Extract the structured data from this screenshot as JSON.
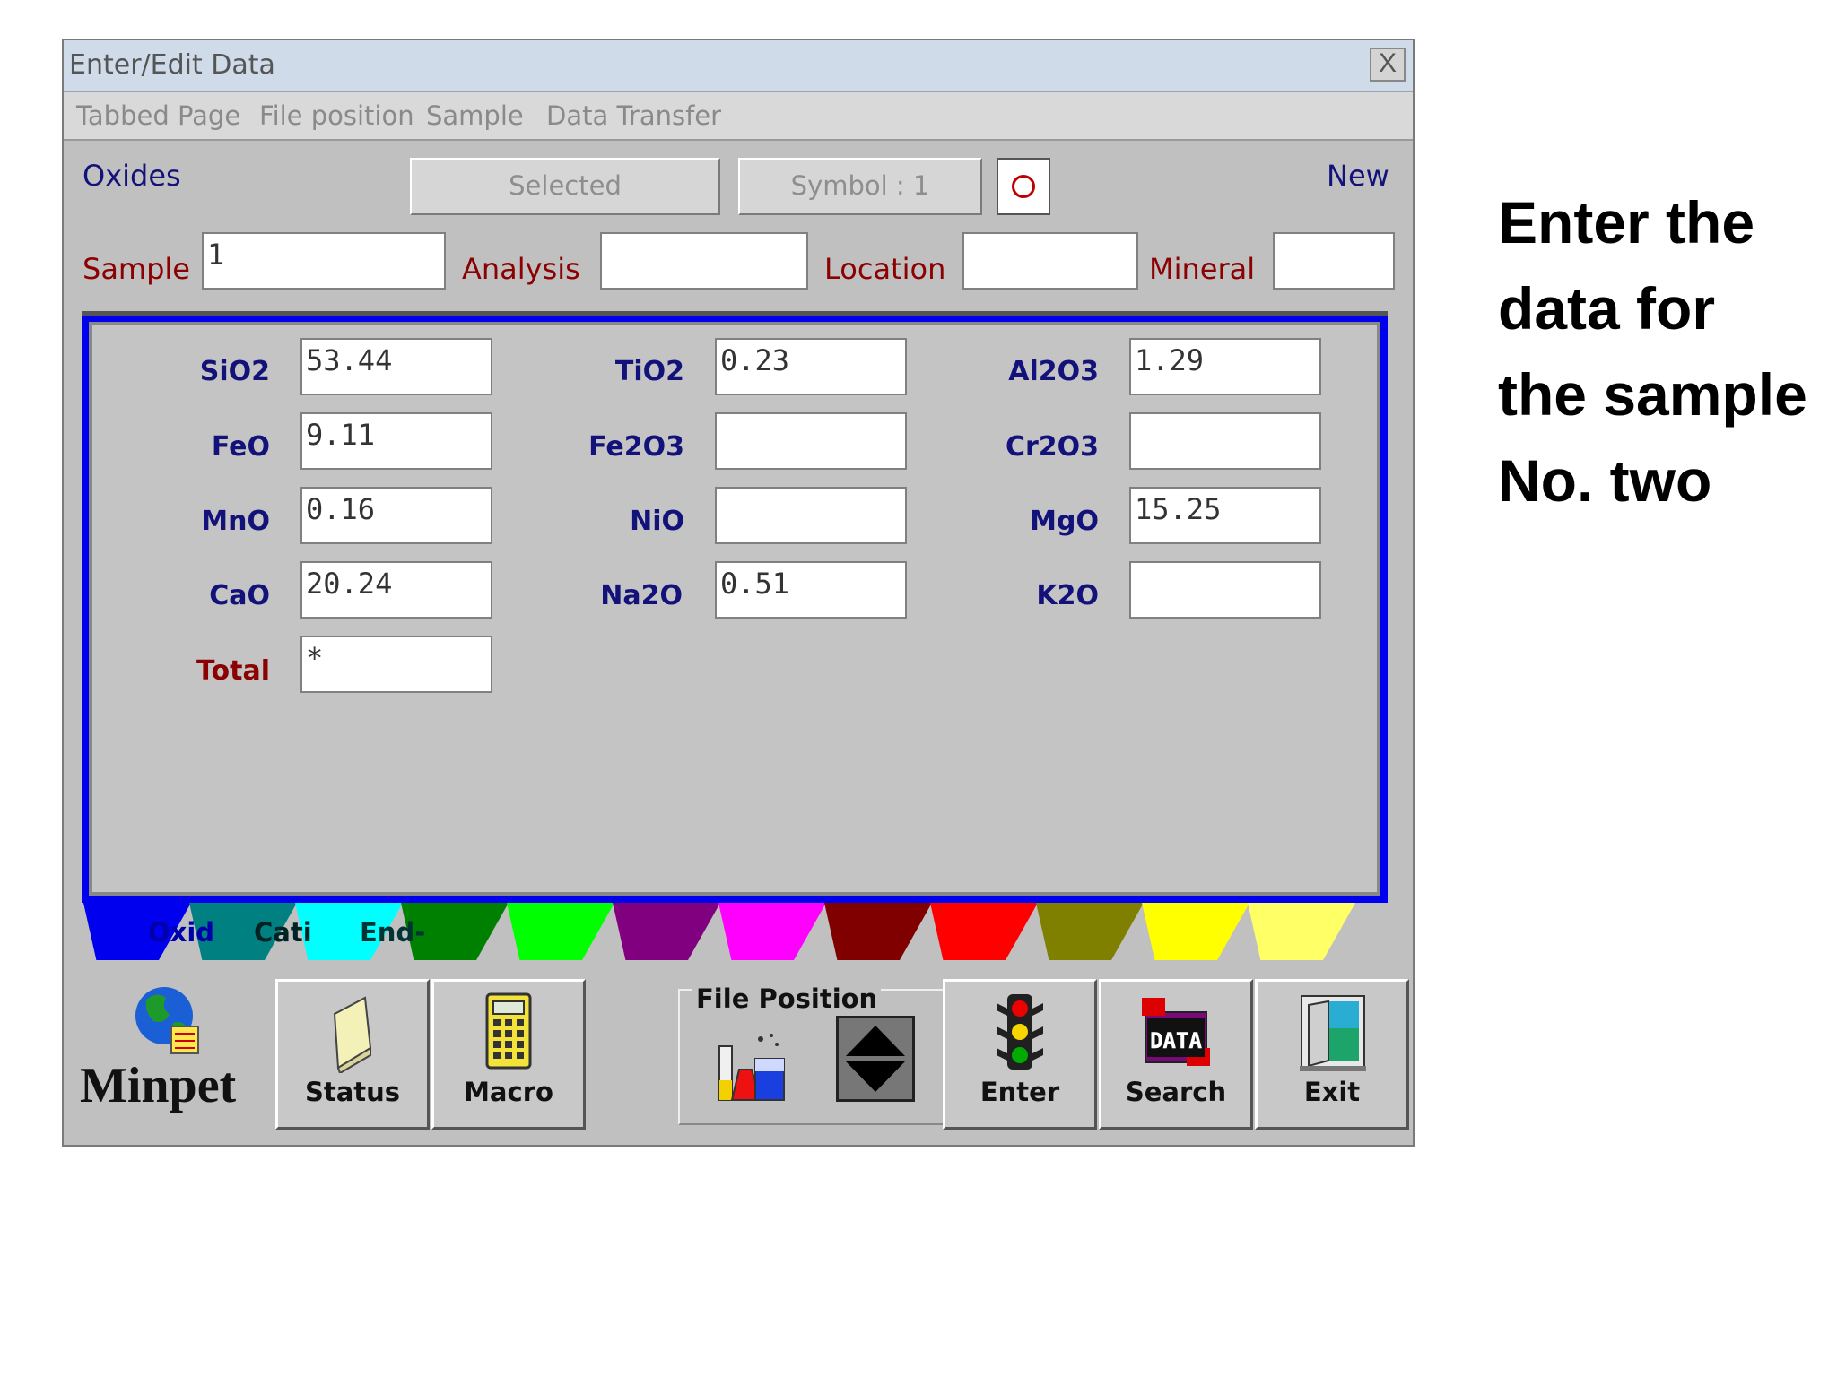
{
  "window": {
    "title": "Enter/Edit Data",
    "close_glyph": "X"
  },
  "menu": [
    "Tabbed Page",
    "File position",
    "Sample",
    "Data Transfer"
  ],
  "top": {
    "oxides_label": "Oxides",
    "selected_label": "Selected",
    "symbol_label": "Symbol : 1",
    "new_label": "New"
  },
  "ids": {
    "sample_label": "Sample",
    "sample_value": "1",
    "analysis_label": "Analysis",
    "analysis_value": "",
    "location_label": "Location",
    "location_value": "",
    "mineral_label": "Mineral",
    "mineral_value": ""
  },
  "oxides": {
    "col1": [
      {
        "label": "SiO2",
        "value": "53.44"
      },
      {
        "label": "FeO",
        "value": "9.11"
      },
      {
        "label": "MnO",
        "value": "0.16"
      },
      {
        "label": "CaO",
        "value": "20.24"
      }
    ],
    "col2": [
      {
        "label": "TiO2",
        "value": "0.23"
      },
      {
        "label": "Fe2O3",
        "value": ""
      },
      {
        "label": "NiO",
        "value": ""
      },
      {
        "label": "Na2O",
        "value": "0.51"
      }
    ],
    "col3": [
      {
        "label": "Al2O3",
        "value": "1.29"
      },
      {
        "label": "Cr2O3",
        "value": ""
      },
      {
        "label": "MgO",
        "value": "15.25"
      },
      {
        "label": "K2O",
        "value": ""
      }
    ],
    "total_label": "Total",
    "total_value": "*"
  },
  "tabs": {
    "labels": [
      "Oxid",
      "Cati",
      "End-"
    ],
    "colors": [
      "#0000ee",
      "#008080",
      "#00ffff",
      "#008000",
      "#00ff00",
      "#800080",
      "#ff00ff",
      "#800000",
      "#ff0000",
      "#808000",
      "#ffff00",
      "#ffff66"
    ]
  },
  "buttons": {
    "logo_text": "Minpet",
    "status": "Status",
    "macro": "Macro",
    "file_position": "File Position",
    "enter": "Enter",
    "search": "Search",
    "search_icon_text": "DATA",
    "exit": "Exit"
  },
  "side_note": [
    "Enter the",
    "data for",
    "the sample",
    "No. two"
  ]
}
